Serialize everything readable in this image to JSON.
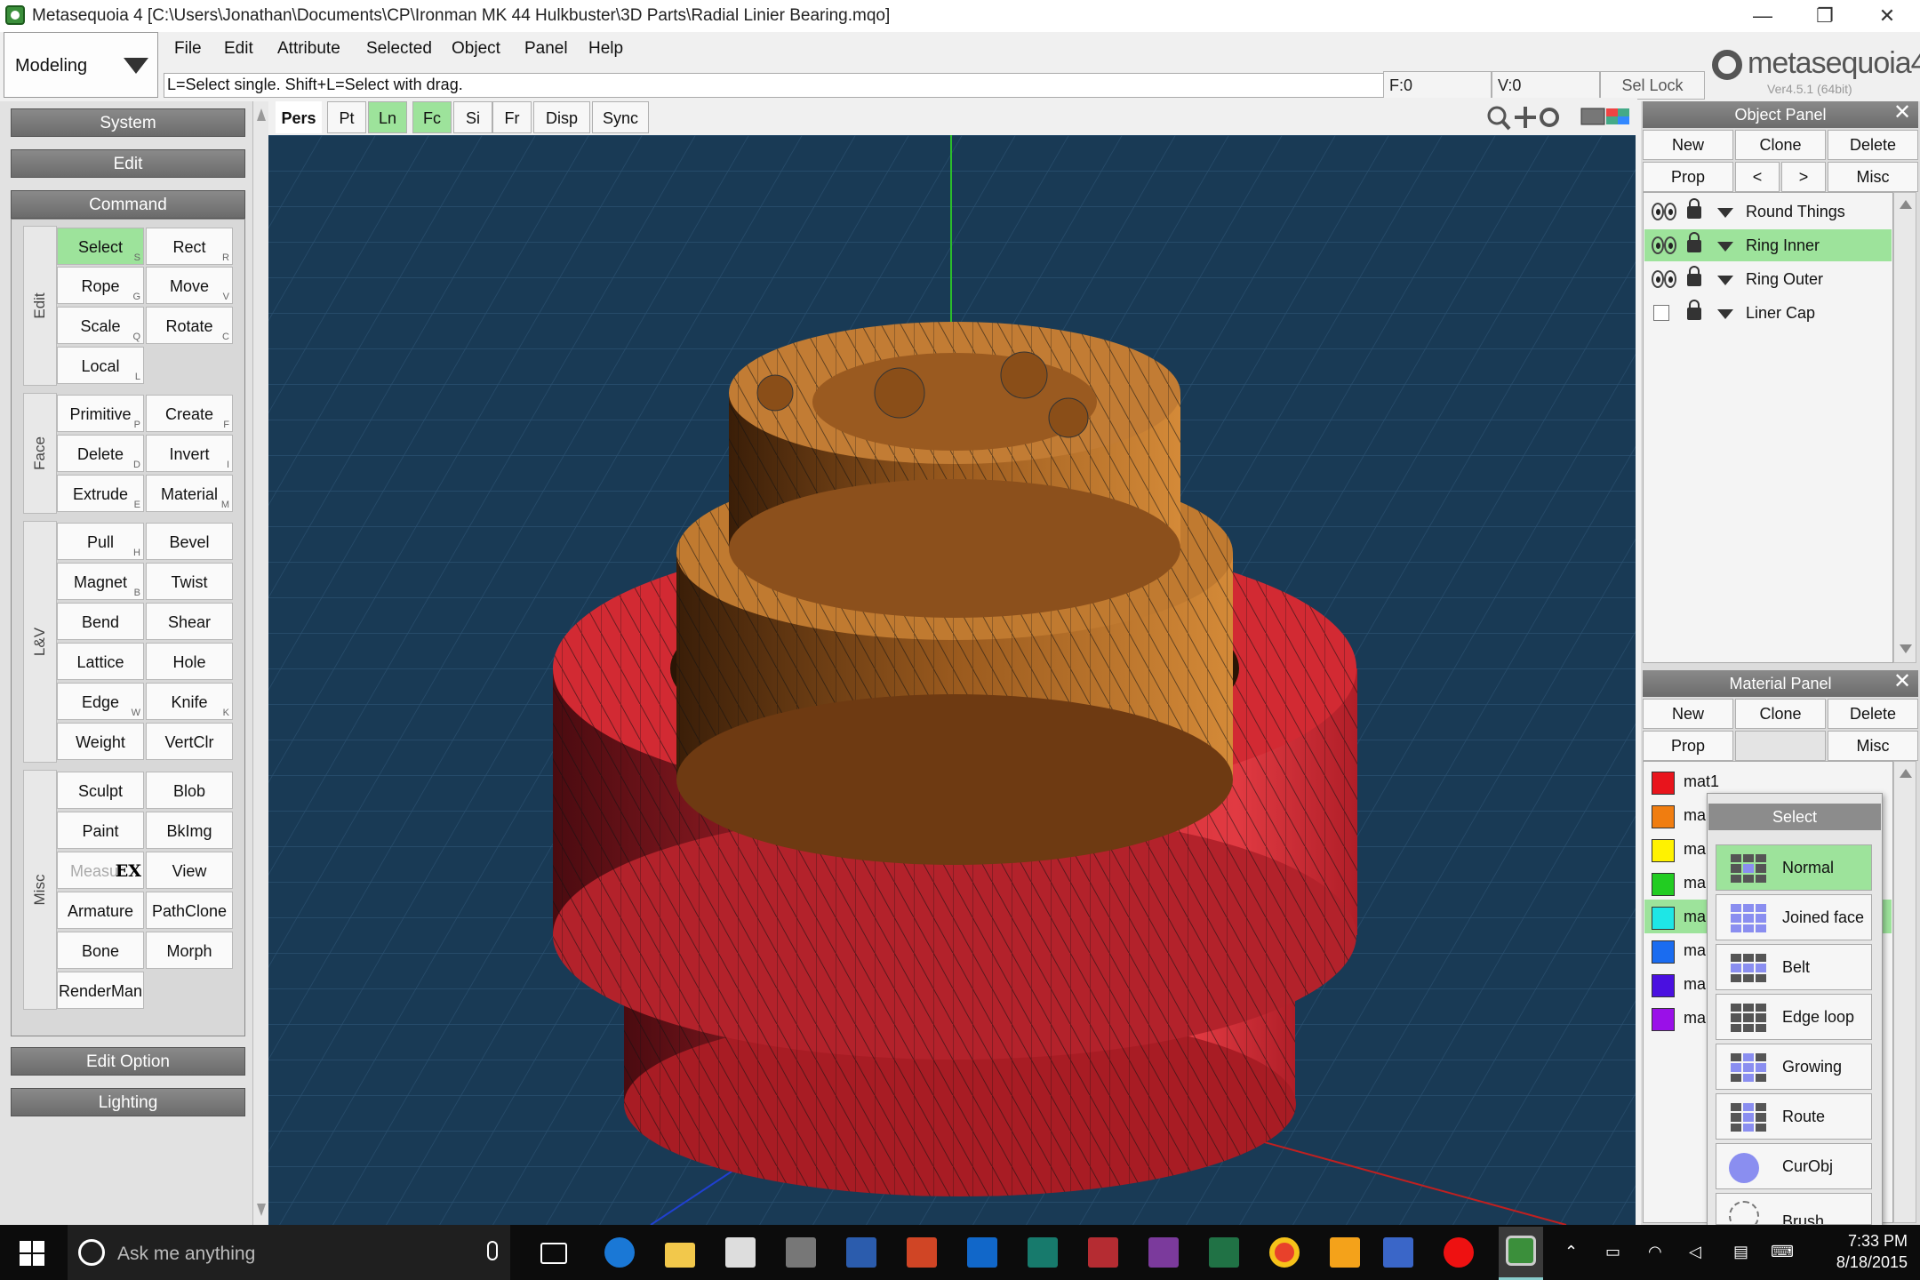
{
  "window": {
    "title": "Metasequoia 4 [C:\\Users\\Jonathan\\Documents\\CP\\Ironman MK 44 Hulkbuster\\3D Parts\\Radial Linier Bearing.mqo]",
    "minimize": "—",
    "restore": "❐",
    "close": "✕"
  },
  "mode": {
    "value": "Modeling"
  },
  "menu": [
    "File",
    "Edit",
    "Attribute",
    "Selected",
    "Object",
    "Panel",
    "Help"
  ],
  "hint": "L=Select single.  Shift+L=Select with drag.",
  "status": {
    "faces": "F:0",
    "vertices": "V:0",
    "sel_lock": "Sel Lock"
  },
  "logo": {
    "name": "metasequoia4",
    "version": "Ver4.5.1 (64bit)"
  },
  "left_panel": {
    "system": "System",
    "edit": "Edit",
    "command": "Command",
    "edit_option": "Edit Option",
    "lighting": "Lighting",
    "groups": {
      "edit": "Edit",
      "face": "Face",
      "lv": "L&V",
      "misc": "Misc"
    },
    "commands": {
      "select": {
        "label": "Select",
        "key": "S"
      },
      "rect": {
        "label": "Rect",
        "key": "R"
      },
      "rope": {
        "label": "Rope",
        "key": "G"
      },
      "move": {
        "label": "Move",
        "key": "V"
      },
      "scale": {
        "label": "Scale",
        "key": "Q"
      },
      "rotate": {
        "label": "Rotate",
        "key": "C"
      },
      "local": {
        "label": "Local",
        "key": "L"
      },
      "primitive": {
        "label": "Primitive",
        "key": "P"
      },
      "create": {
        "label": "Create",
        "key": "F"
      },
      "delete": {
        "label": "Delete",
        "key": "D"
      },
      "invert": {
        "label": "Invert",
        "key": "I"
      },
      "extrude": {
        "label": "Extrude",
        "key": "E"
      },
      "material": {
        "label": "Material",
        "key": "M"
      },
      "pull": {
        "label": "Pull",
        "key": "H"
      },
      "bevel": {
        "label": "Bevel",
        "key": ""
      },
      "magnet": {
        "label": "Magnet",
        "key": "B"
      },
      "twist": {
        "label": "Twist",
        "key": ""
      },
      "bend": {
        "label": "Bend",
        "key": ""
      },
      "shear": {
        "label": "Shear",
        "key": ""
      },
      "lattice": {
        "label": "Lattice",
        "key": ""
      },
      "hole": {
        "label": "Hole",
        "key": ""
      },
      "edge": {
        "label": "Edge",
        "key": "W"
      },
      "knife": {
        "label": "Knife",
        "key": "K"
      },
      "weight": {
        "label": "Weight",
        "key": ""
      },
      "vertclr": {
        "label": "VertClr",
        "key": ""
      },
      "sculpt": {
        "label": "Sculpt",
        "key": ""
      },
      "blob": {
        "label": "Blob",
        "key": ""
      },
      "paint": {
        "label": "Paint",
        "key": ""
      },
      "bkimg": {
        "label": "BkImg",
        "key": ""
      },
      "measure": {
        "label": "Measur",
        "badge": "EX"
      },
      "view": {
        "label": "View",
        "key": ""
      },
      "armature": {
        "label": "Armature",
        "key": ""
      },
      "pathclone": {
        "label": "PathClone",
        "key": ""
      },
      "bone": {
        "label": "Bone",
        "key": ""
      },
      "morph": {
        "label": "Morph",
        "key": ""
      },
      "renderman": {
        "label": "RenderMan",
        "key": ""
      }
    }
  },
  "view_toolbar": [
    "Pers",
    "Pt",
    "Ln",
    "Fc",
    "Si",
    "Fr",
    "Disp",
    "Sync"
  ],
  "object_panel": {
    "title": "Object Panel",
    "buttons": [
      "New",
      "Clone",
      "Delete",
      "Prop",
      "<",
      ">",
      "Misc"
    ],
    "objects": [
      "Round Things",
      "Ring Inner",
      "Ring Outer",
      "Liner Cap"
    ],
    "selected_index": 1
  },
  "material_panel": {
    "title": "Material Panel",
    "buttons": [
      "New",
      "Clone",
      "Delete",
      "Prop",
      "Misc"
    ],
    "materials": [
      {
        "name": "mat1",
        "color": "#e8141c"
      },
      {
        "name": "ma",
        "color": "#f07d10"
      },
      {
        "name": "ma",
        "color": "#fff200"
      },
      {
        "name": "ma",
        "color": "#22cc22"
      },
      {
        "name": "ma",
        "color": "#1ee6e6"
      },
      {
        "name": "ma",
        "color": "#1a6cf0"
      },
      {
        "name": "ma",
        "color": "#4a10e0"
      },
      {
        "name": "ma",
        "color": "#9a10e8"
      }
    ],
    "selected_index": 4
  },
  "select_popup": {
    "title": "Select",
    "options": [
      "Normal",
      "Joined face",
      "Belt",
      "Edge loop",
      "Growing",
      "Route",
      "CurObj",
      "Brush"
    ],
    "selected_index": 0
  },
  "taskbar": {
    "search_placeholder": "Ask me anything",
    "time": "7:33 PM",
    "date": "8/18/2015"
  },
  "colors": {
    "accent_green": "#9de39b",
    "viewport_bg": "#193a55",
    "part_red": "#d62a32",
    "part_orange": "#c8782a"
  }
}
